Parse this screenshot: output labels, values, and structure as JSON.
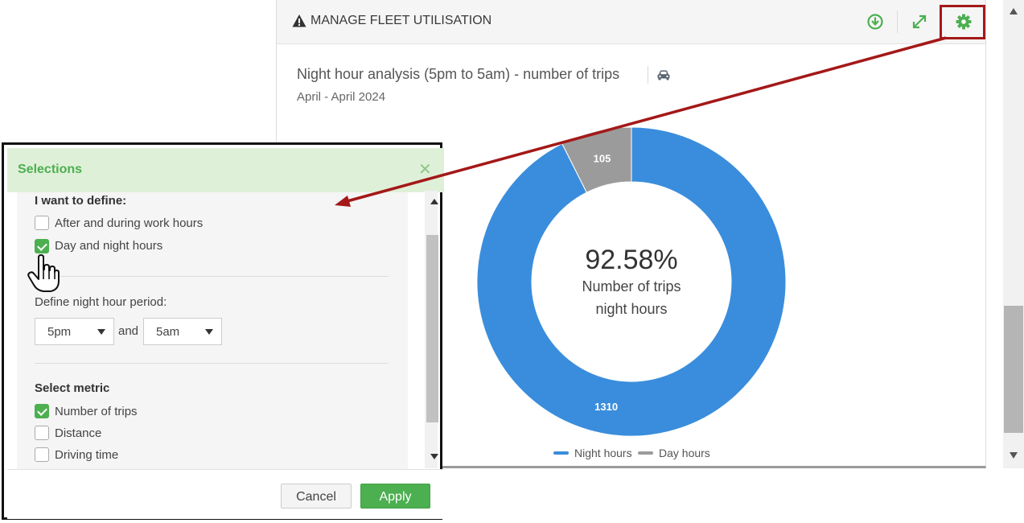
{
  "widget": {
    "title": "MANAGE FLEET UTILISATION",
    "header_icons": [
      "download-icon",
      "expand-icon",
      "gear-icon"
    ],
    "accent_color": "#4caf50"
  },
  "chart_title": "Night hour analysis (5pm to 5am) - number of trips",
  "chart_subtitle": "April - April 2024",
  "center": {
    "percent": "92.58%",
    "line1": "Number of trips",
    "line2": "night hours"
  },
  "chart_data": {
    "type": "pie",
    "categories": [
      "Night hours",
      "Day hours"
    ],
    "values": [
      1310,
      105
    ],
    "colors": [
      "#3a8ddc",
      "#9b9b9b"
    ],
    "labels": [
      "1310",
      "105"
    ],
    "legend": "bottom"
  },
  "dialog": {
    "title": "Selections",
    "define_label": "I want to define:",
    "define_options": [
      {
        "label": "After and during work hours",
        "checked": false
      },
      {
        "label": "Day and night hours",
        "checked": true
      }
    ],
    "night_period_label": "Define night hour period:",
    "from_value": "5pm",
    "and_label": "and",
    "to_value": "5am",
    "metric_label": "Select metric",
    "metric_options": [
      {
        "label": "Number of trips",
        "checked": true
      },
      {
        "label": "Distance",
        "checked": false
      },
      {
        "label": "Driving time",
        "checked": false
      }
    ],
    "cancel_label": "Cancel",
    "apply_label": "Apply"
  }
}
